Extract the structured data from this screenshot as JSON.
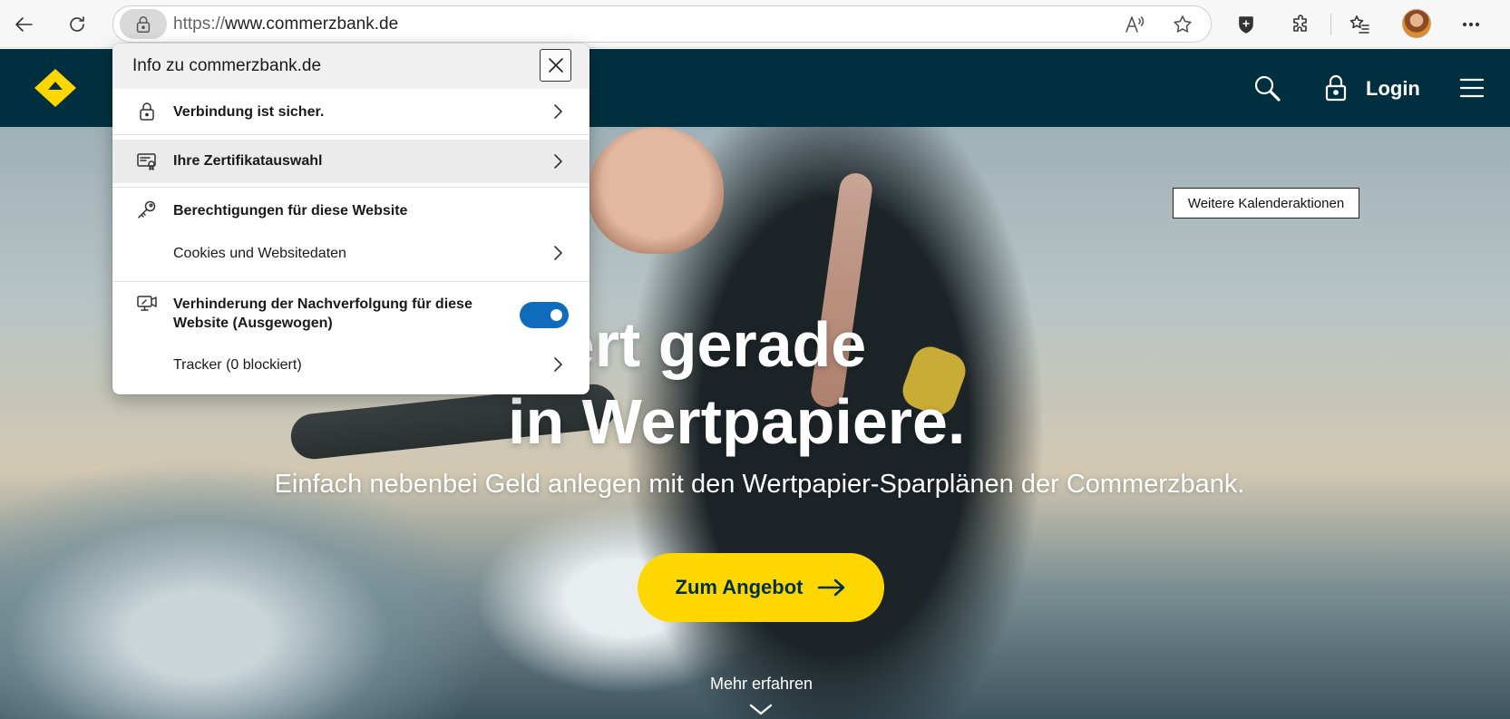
{
  "browser": {
    "url_protocol": "https://",
    "url_host": "www.commerzbank.de",
    "icons": {
      "back": "arrow-left-icon",
      "refresh": "refresh-icon",
      "site_info": "lock-icon",
      "read_aloud": "read-aloud-icon",
      "favorite": "star-icon",
      "browser_essentials": "shield-icon",
      "extensions": "puzzle-icon",
      "favorites": "favorites-list-icon",
      "profile": "avatar",
      "more": "more-dots-icon"
    }
  },
  "site_info_flyout": {
    "title": "Info zu commerzbank.de",
    "rows": [
      {
        "label": "Verbindung ist sicher.",
        "icon": "lock-icon"
      },
      {
        "label": "Ihre Zertifikatauswahl",
        "icon": "certificate-icon"
      },
      {
        "label": "Berechtigungen für diese Website",
        "icon": "key-icon"
      },
      {
        "label": "Cookies und Websitedaten"
      },
      {
        "label_line1": "Verhinderung der Nachverfolgung für diese",
        "label_line2": "Website (Ausgewogen)",
        "icon": "tracking-prevention-icon",
        "toggle_on": true
      },
      {
        "label": "Tracker (0 blockiert)"
      }
    ],
    "toggle_color": "#0f6cbd",
    "hover_row_color": "#ebebeb"
  },
  "site_header": {
    "login_label": "Login",
    "background": "#00303f",
    "logo_color": "#ffd700"
  },
  "hero": {
    "title_line1": "investiert gerade",
    "title_line2": "in Wertpapiere.",
    "subtitle": "Einfach nebenbei Geld anlegen mit den Wertpapier-Sparplänen der Commerzbank.",
    "cta_label": "Zum Angebot",
    "cta_color": "#ffd700",
    "more_label": "Mehr erfahren",
    "calendar_button": "Weitere Kalenderaktionen"
  }
}
